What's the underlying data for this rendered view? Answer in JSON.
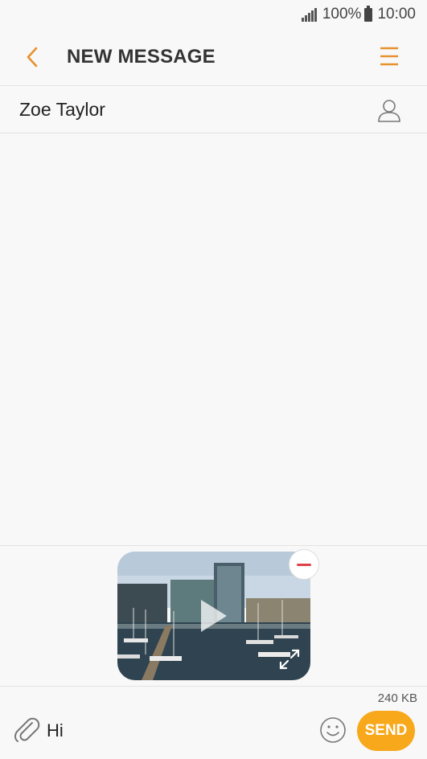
{
  "status_bar": {
    "battery": "100%",
    "time": "10:00"
  },
  "header": {
    "title": "NEW MESSAGE",
    "back_icon": "chevron-left-icon",
    "menu_icon": "menu-icon"
  },
  "recipient": {
    "name": "Zoe Taylor",
    "contact_icon": "contact-icon"
  },
  "attachment": {
    "type": "video",
    "play_icon": "play-icon",
    "expand_icon": "expand-icon",
    "remove_icon": "remove-icon"
  },
  "composer": {
    "size": "240 KB",
    "text": "Hi",
    "send_label": "SEND",
    "attach_icon": "paperclip-icon",
    "emoji_icon": "emoji-icon"
  },
  "colors": {
    "accent": "#e8912f",
    "send": "#f7a81b",
    "remove": "#e0404a"
  }
}
